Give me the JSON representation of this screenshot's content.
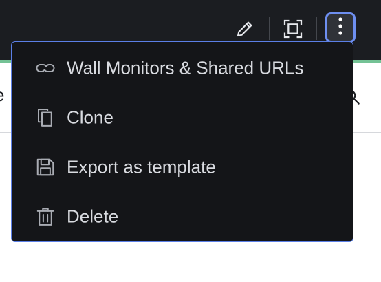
{
  "toolbar": {
    "edit_icon": "pencil-icon",
    "fullscreen_icon": "fullscreen-icon",
    "more_icon": "kebab-menu-icon",
    "focus_ring_color": "#6e8ff0"
  },
  "menu": {
    "items": [
      {
        "label": "Wall Monitors & Shared URLs",
        "icon": "link-icon"
      },
      {
        "label": "Clone",
        "icon": "copy-icon"
      },
      {
        "label": "Export as template",
        "icon": "save-icon"
      },
      {
        "label": "Delete",
        "icon": "trash-icon"
      }
    ]
  },
  "background": {
    "partial_text": "e",
    "search_icon": "search-icon"
  }
}
